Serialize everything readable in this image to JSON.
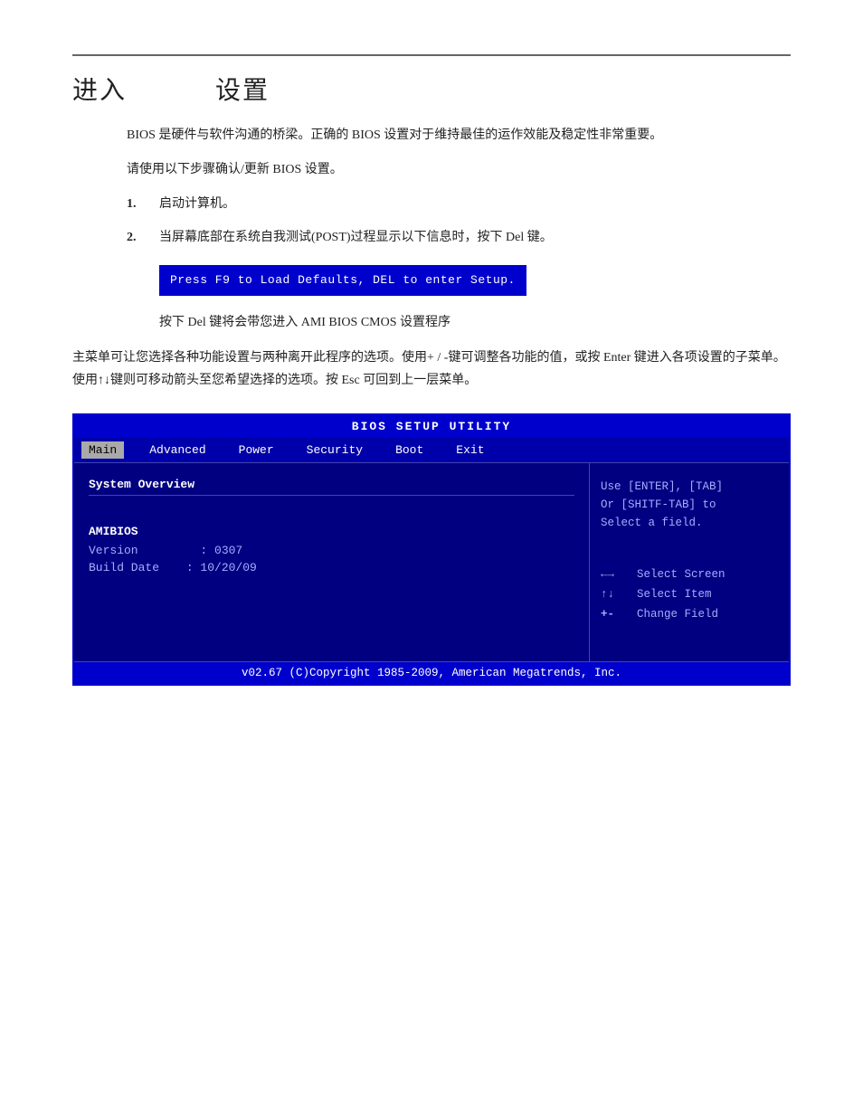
{
  "page": {
    "top_rule": true,
    "title": {
      "part1": "进入",
      "tab": "",
      "part2": "设置"
    },
    "intro1": "BIOS 是硬件与软件沟通的桥梁。正确的 BIOS 设置对于维持最佳的运作效能及稳定性非常重要。",
    "intro2": "请使用以下步骤确认/更新 BIOS 设置。",
    "steps": [
      {
        "num": "1.",
        "text": "启动计算机。"
      },
      {
        "num": "2.",
        "text": "当屏幕底部在系统自我测试(POST)过程显示以下信息时，按下 Del 键。",
        "code": "Press F9 to Load Defaults, DEL to enter Setup.",
        "sub": "按下 Del 键将会带您进入 AMI BIOS CMOS 设置程序"
      }
    ],
    "main_para": "主菜单可让您选择各种功能设置与两种离开此程序的选项。使用+ / -键可调整各功能的值，或按 Enter 键进入各项设置的子菜单。使用↑↓键则可移动箭头至您希望选择的选项。按 Esc 可回到上一层菜单。"
  },
  "bios": {
    "title_bar": "BIOS  SETUP  UTILITY",
    "nav": {
      "items": [
        {
          "label": "Main",
          "active": true
        },
        {
          "label": "Advanced",
          "active": false
        },
        {
          "label": "Power",
          "active": false
        },
        {
          "label": "Security",
          "active": false
        },
        {
          "label": "Boot",
          "active": false
        },
        {
          "label": "Exit",
          "active": false
        }
      ]
    },
    "left": {
      "section_title": "System Overview",
      "subsection": "AMIBIOS",
      "items": [
        {
          "label": "Version",
          "sep": ":",
          "value": "0307"
        },
        {
          "label": "Build Date",
          "sep": ":",
          "value": "10/20/09"
        }
      ]
    },
    "right": {
      "hint1": "Use [ENTER], [TAB]",
      "hint2": "Or [SHITF-TAB] to",
      "hint3": "Select a field.",
      "shortcuts": [
        {
          "key": "←→",
          "desc": "Select Screen"
        },
        {
          "key": "↑↓",
          "desc": "Select Item"
        },
        {
          "key": "+-",
          "desc": "Change Field"
        }
      ]
    },
    "footer": "v02.67  (C)Copyright 1985-2009, American Megatrends, Inc."
  }
}
